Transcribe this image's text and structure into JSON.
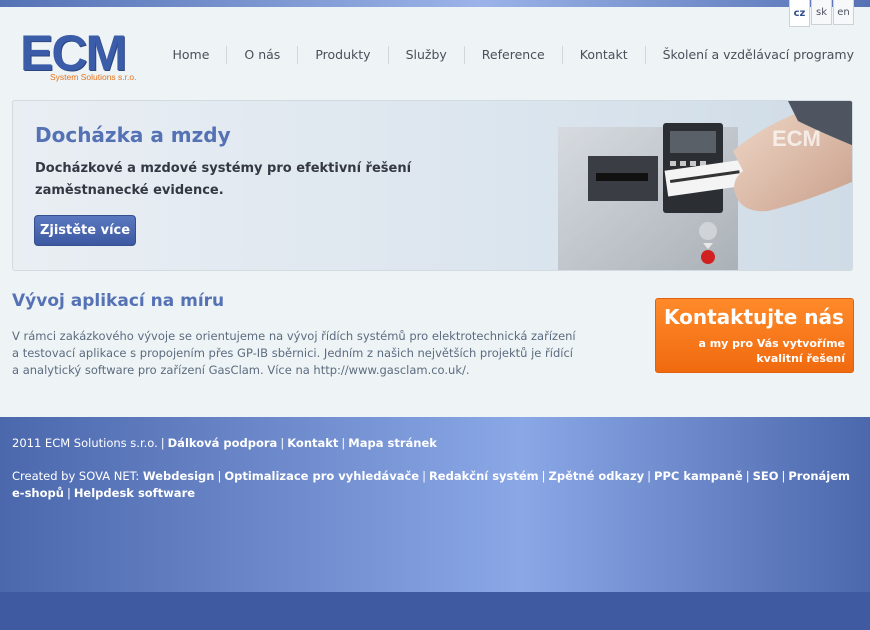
{
  "languages": [
    {
      "code": "cz",
      "active": true
    },
    {
      "code": "sk",
      "active": false
    },
    {
      "code": "en",
      "active": false
    }
  ],
  "logo": {
    "big": "ECM",
    "small": "System Solutions s.r.o."
  },
  "nav": [
    "Home",
    "O nás",
    "Produkty",
    "Služby",
    "Reference",
    "Kontakt",
    "Školení a vzdělávací programy"
  ],
  "hero": {
    "title": "Docházka a mzdy",
    "subtitle": "Docházkové a mzdové systémy pro efektivní řešení zaměstnanecké evidence.",
    "button": "Zjistěte více",
    "image_text": "ECM"
  },
  "section": {
    "title": "Vývoj aplikací na míru",
    "text": "V rámci zakázkového vývoje se orientujeme na vývoj řídích systémů pro elektrotechnická zařízení a testovací aplikace s propojením přes GP-IB sběrnici. Jedním z našich největších projektů je řídící a analytický software pro zařízení GasClam. Více na http://www.gasclam.co.uk/."
  },
  "cta": {
    "title": "Kontaktujte nás",
    "line1": "a my pro Vás vytvoříme",
    "line2": "kvalitní řešení"
  },
  "footer": {
    "copyright": "2011 ECM Solutions s.r.o.",
    "links1": [
      "Dálková podpora",
      "Kontakt",
      "Mapa stránek"
    ],
    "created_by": "Created by SOVA NET:",
    "links2": [
      "Webdesign",
      "Optimalizace pro vyhledávače",
      "Redakční systém",
      "Zpětné odkazy",
      "PPC kampaně",
      "SEO",
      "Pronájem e-shopů",
      "Helpdesk software"
    ]
  }
}
